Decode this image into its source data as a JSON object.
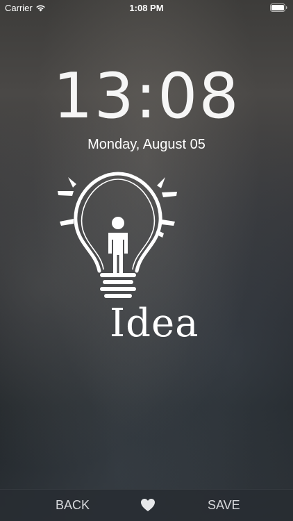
{
  "status_bar": {
    "carrier": "Carrier",
    "time": "1:08 PM"
  },
  "lock_screen": {
    "clock": "13:08",
    "date": "Monday, August 05"
  },
  "wallpaper": {
    "logo_text": "Idea"
  },
  "bottom_bar": {
    "back_label": "BACK",
    "save_label": "SAVE",
    "favorite_icon": "heart-icon"
  },
  "colors": {
    "text": "#ffffff",
    "bar_text": "#d8dadd",
    "bar_background": "#282c32"
  }
}
